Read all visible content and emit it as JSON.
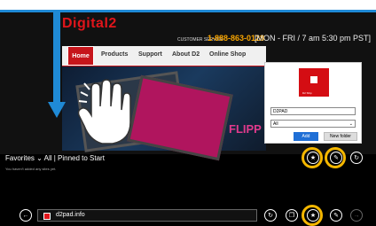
{
  "site": {
    "logo_main": "Digital",
    "logo_accent": "2",
    "customer_service": "CUSTOMER SERVICE",
    "phone": "1-888-863-0128",
    "hours": "[MON - FRI / 7 am 5:30 pm PST]",
    "nav": [
      "Home",
      "Products",
      "Support",
      "About D2",
      "Online Shop"
    ],
    "hero_text": "FLIPP"
  },
  "popup": {
    "thumb_label": "D2 Ship",
    "name_value": "D2PAD",
    "folder_value": "All",
    "add_label": "Add",
    "new_folder_label": "New folder"
  },
  "favorites": {
    "title": "Favorites ⌄ All | Pinned to Start",
    "message": "You haven't added any sites yet."
  },
  "address_bar": {
    "url": "d2pad.info"
  },
  "icons": {
    "back": "←",
    "refresh": "↻",
    "tabs": "❐",
    "star": "★",
    "wrench": "✎",
    "forward": "→",
    "pin": "📌"
  },
  "colors": {
    "accent_blue": "#1f8ad6",
    "highlight_yellow": "#f5b700",
    "brand_red": "#c6151b"
  }
}
